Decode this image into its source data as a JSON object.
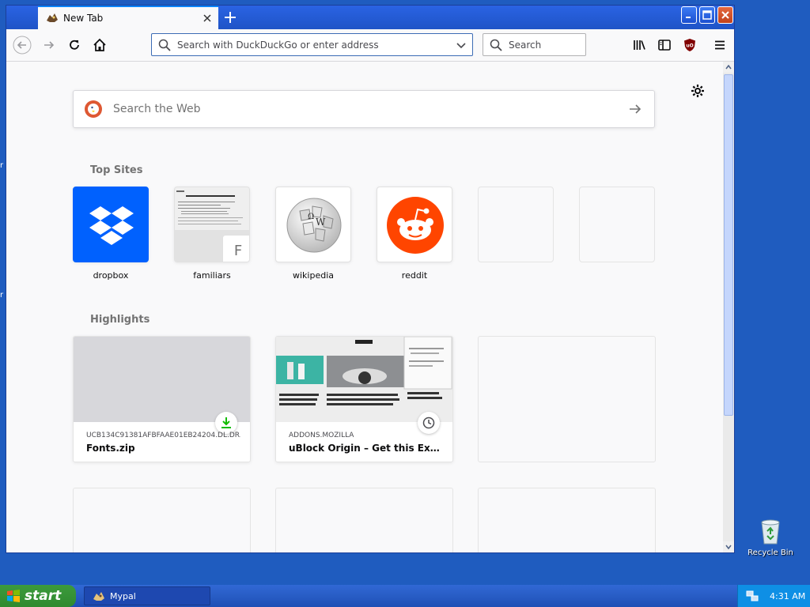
{
  "browser": {
    "tab": {
      "title": "New Tab"
    },
    "urlbar": {
      "placeholder": "Search with DuckDuckGo or enter address"
    },
    "searchbar": {
      "placeholder": "Search"
    }
  },
  "newtab": {
    "web_search": {
      "placeholder": "Search the Web"
    },
    "top_sites_title": "Top Sites",
    "top_sites": [
      {
        "label": "dropbox"
      },
      {
        "label": "familiars",
        "fallback_letter": "F"
      },
      {
        "label": "wikipedia"
      },
      {
        "label": "reddit"
      }
    ],
    "highlights_title": "Highlights",
    "highlights": [
      {
        "context": "UCB134C91381AFBFAAE01EB24204.DL.DR...",
        "title": "Fonts.zip",
        "badge": "download-icon"
      },
      {
        "context": "ADDONS.MOZILLA",
        "title": "uBlock Origin – Get this Extensio...",
        "badge": "clock-icon"
      }
    ]
  },
  "desktop": {
    "recycle_bin_label": "Recycle Bin"
  },
  "taskbar": {
    "start_label": "start",
    "task_label": "Mypal",
    "clock": "4:31 AM"
  },
  "colors": {
    "tab_accent": "#0a84ff",
    "dropbox": "#0061fe",
    "reddit": "#ff4500",
    "duckduckgo": "#de5833"
  }
}
